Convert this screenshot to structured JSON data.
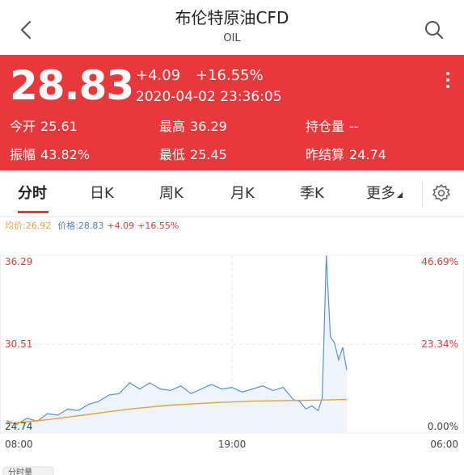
{
  "header": {
    "title": "布伦特原油CFD",
    "subtitle": "OIL"
  },
  "quote": {
    "price": "28.83",
    "change": "+4.09",
    "change_pct": "+16.55%",
    "timestamp": "2020-04-02 23:36:05",
    "stats": {
      "open_label": "今开",
      "open_value": "25.61",
      "high_label": "最高",
      "high_value": "36.29",
      "oi_label": "持仓量",
      "oi_value": "--",
      "amp_label": "振幅",
      "amp_value": "43.82%",
      "low_label": "最低",
      "low_value": "25.45",
      "prev_label": "昨结算",
      "prev_value": "24.74"
    }
  },
  "tabs": [
    {
      "label": "分时",
      "active": true
    },
    {
      "label": "日K",
      "active": false
    },
    {
      "label": "周K",
      "active": false
    },
    {
      "label": "月K",
      "active": false
    },
    {
      "label": "季K",
      "active": false
    },
    {
      "label": "更多",
      "active": false
    }
  ],
  "legend": {
    "avg": "均价:26.92",
    "price": "价格:28.83",
    "change": "+4.09",
    "change_pct": "+16.55%"
  },
  "bottom_tab": {
    "label": "分时量"
  },
  "colors": {
    "red": "#e7393b",
    "price_line": "#5b8fd8",
    "avg_line": "#e0a33d",
    "green": "#2a9d3a"
  },
  "chart_data": {
    "type": "line",
    "title": "",
    "xlabel": "",
    "ylabel": "",
    "x_tick_labels": [
      "08:00",
      "19:00",
      "06:00"
    ],
    "y_left_ticks": [
      "36.29",
      "30.51",
      "24.74"
    ],
    "y_right_ticks": [
      "46.69%",
      "23.34%",
      "0.00%"
    ],
    "ylim": [
      24.74,
      36.29
    ],
    "x_range_hours": [
      0,
      22
    ],
    "grid": true,
    "series": [
      {
        "name": "价格",
        "x": [
          0,
          0.5,
          1.0,
          1.5,
          2.0,
          2.5,
          3.0,
          3.5,
          4.0,
          4.5,
          5.0,
          5.5,
          6.0,
          6.5,
          7.0,
          7.5,
          8.0,
          8.5,
          9.0,
          9.5,
          10.0,
          10.5,
          11.0,
          11.5,
          12.0,
          12.5,
          13.0,
          13.5,
          14.0,
          14.3,
          14.6,
          14.9,
          15.2,
          15.4,
          15.6,
          15.8,
          16.0,
          16.2,
          16.4,
          16.6
        ],
        "values": [
          25.55,
          25.3,
          25.7,
          25.5,
          26.0,
          25.9,
          26.3,
          26.2,
          26.6,
          26.8,
          27.2,
          27.3,
          28.0,
          27.6,
          28.0,
          27.6,
          27.5,
          27.8,
          27.3,
          27.6,
          27.9,
          27.6,
          27.7,
          27.4,
          27.6,
          27.8,
          27.5,
          27.7,
          26.9,
          26.8,
          26.3,
          26.5,
          26.2,
          27.0,
          36.29,
          31.0,
          30.6,
          29.5,
          30.3,
          28.83
        ]
      },
      {
        "name": "均价",
        "x": [
          0,
          2,
          4,
          6,
          8,
          10,
          12,
          14,
          15.5,
          16.6
        ],
        "values": [
          25.35,
          25.6,
          25.95,
          26.3,
          26.55,
          26.7,
          26.82,
          26.85,
          26.88,
          26.92
        ]
      }
    ]
  }
}
